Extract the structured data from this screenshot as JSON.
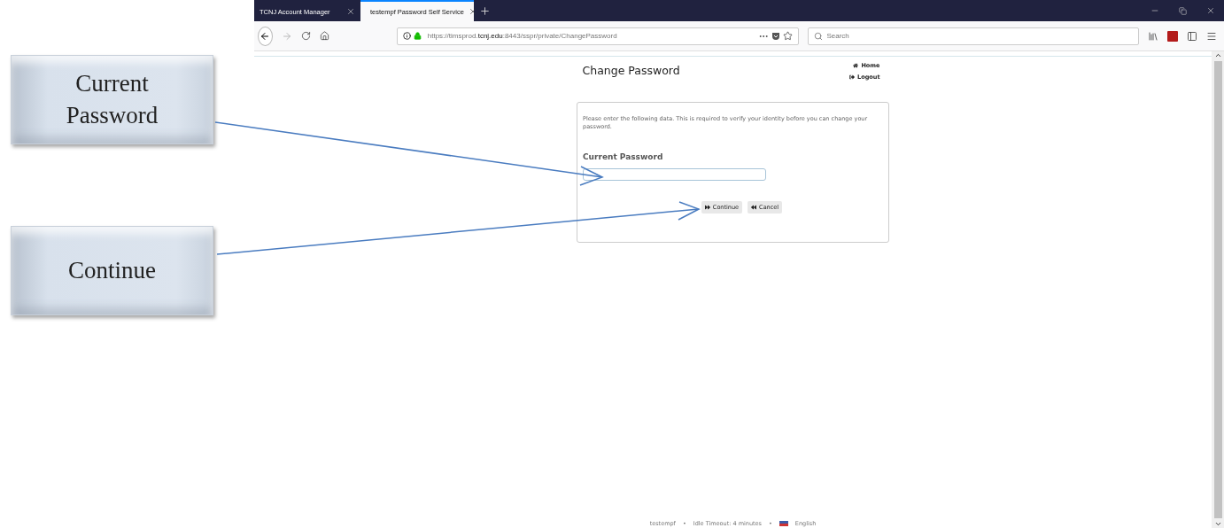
{
  "annotations": [
    {
      "text": "Current Password"
    },
    {
      "text": "Continue"
    }
  ],
  "browser": {
    "tabs": [
      {
        "label": "TCNJ Account Manager",
        "selected": false
      },
      {
        "label": "testempf Password Self Service",
        "selected": true
      }
    ],
    "address": {
      "prefix": "https://timsprod.",
      "domain": "tcnj.edu",
      "suffix": ":8443/sspr/private/ChangePassword"
    },
    "search": {
      "placeholder": "Search"
    }
  },
  "page": {
    "title": "Change Password",
    "nav": [
      "Home",
      "Logout"
    ],
    "instructions": "Please enter the following data. This is required to verify your identity before you can change your password.",
    "field_label": "Current Password",
    "buttons": [
      "Continue",
      "Cancel"
    ],
    "footer": [
      "testempf",
      "Idle Timeout: 4 minutes",
      "English"
    ],
    "footer_separator": "•"
  }
}
